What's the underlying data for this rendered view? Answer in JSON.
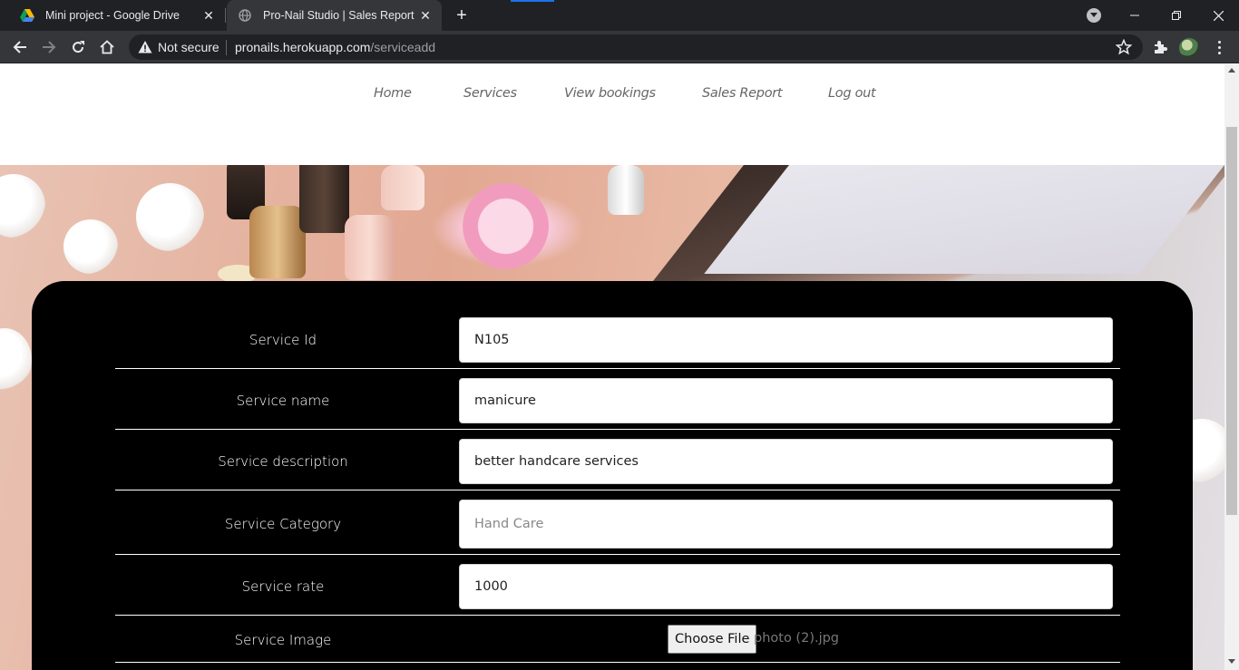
{
  "browser": {
    "tabs": [
      {
        "title": "Mini project - Google Drive",
        "active": false
      },
      {
        "title": "Pro-Nail Studio | Sales Report",
        "active": true
      }
    ],
    "address": {
      "security_label": "Not secure",
      "host": "pronails.herokuapp.com",
      "path": "/serviceadd"
    },
    "accent_color": "#1a73e8"
  },
  "nav": {
    "items": [
      "Home",
      "Services",
      "View bookings",
      "Sales Report",
      "Log out"
    ]
  },
  "form": {
    "rows": [
      {
        "label": "Service Id",
        "value": "N105"
      },
      {
        "label": "Service name",
        "value": "manicure"
      },
      {
        "label": "Service description",
        "value": "better handcare services"
      },
      {
        "label": "Service Category",
        "placeholder": "Hand Care"
      },
      {
        "label": "Service rate",
        "value": "1000"
      },
      {
        "label": "Service Image",
        "button": "Choose File",
        "file_name": "photo (2).jpg"
      }
    ]
  }
}
